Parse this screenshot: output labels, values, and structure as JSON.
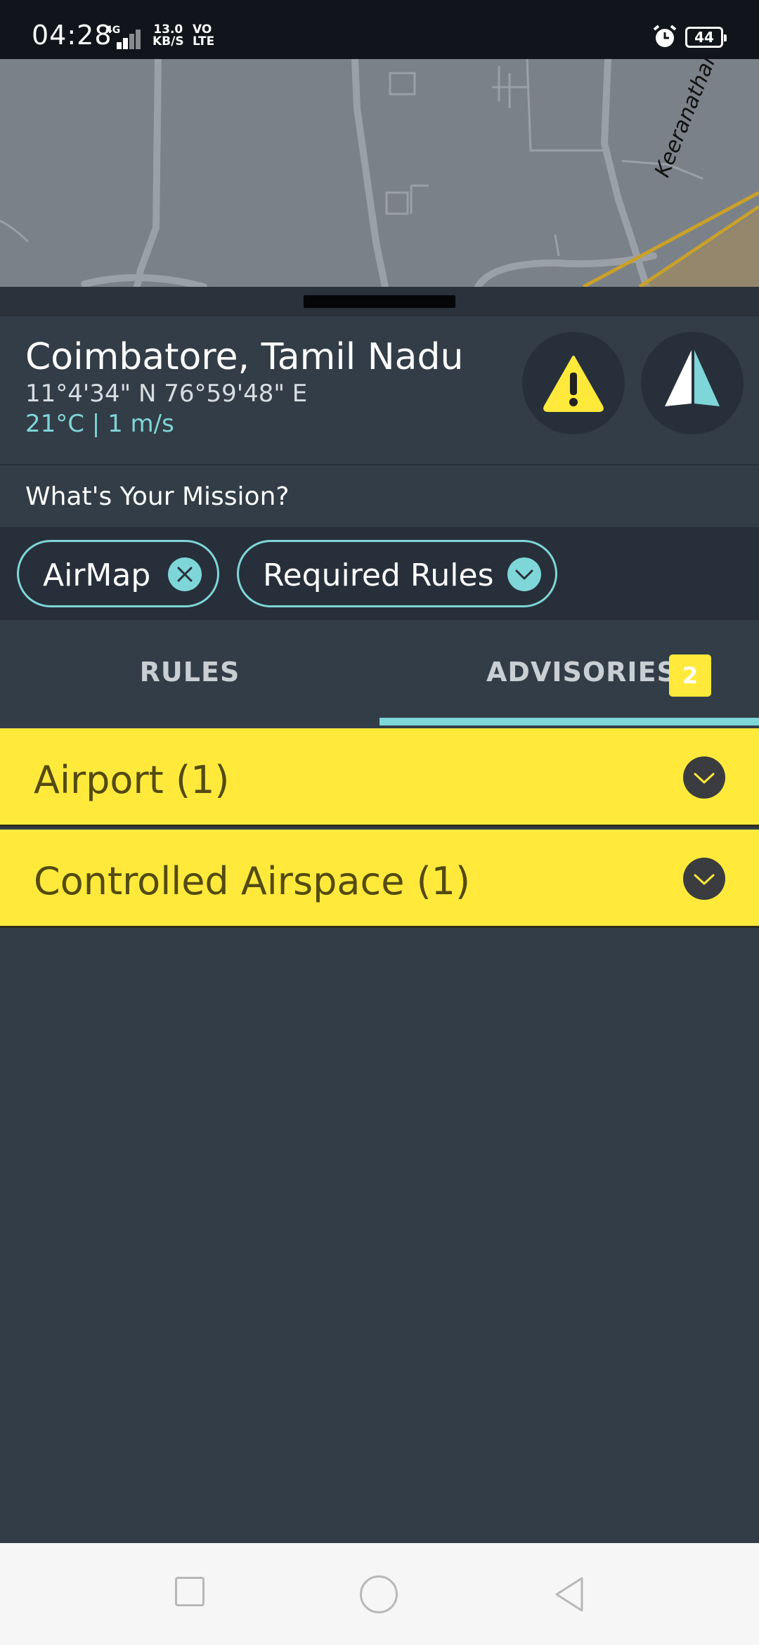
{
  "status_bar": {
    "time": "04:28",
    "network": "4G",
    "speed_value": "13.0",
    "speed_unit": "KB/S",
    "volte_top": "VO",
    "volte_bottom": "LTE",
    "battery": "44"
  },
  "map": {
    "road_label": "Keeranatham R"
  },
  "location": {
    "title": "Coimbatore, Tamil Nadu",
    "coordinates": "11°4'34\" N  76°59'48\" E",
    "weather": "21°C | 1 m/s"
  },
  "mission": {
    "label": "What's Your Mission?"
  },
  "chips": [
    {
      "label": "AirMap",
      "icon": "close-icon"
    },
    {
      "label": "Required Rules",
      "icon": "chevron-down-icon"
    }
  ],
  "tabs": {
    "rules_label": "RULES",
    "advisories_label": "ADVISORIES",
    "advisories_count": "2",
    "selected": "advisories"
  },
  "advisories": [
    {
      "title": "Airport (1)"
    },
    {
      "title": "Controlled Airspace (1)"
    }
  ],
  "colors": {
    "accent": "#7fd6d8",
    "warning": "#ffea3b",
    "panel": "#323d47",
    "panel_dark": "#27303a"
  }
}
